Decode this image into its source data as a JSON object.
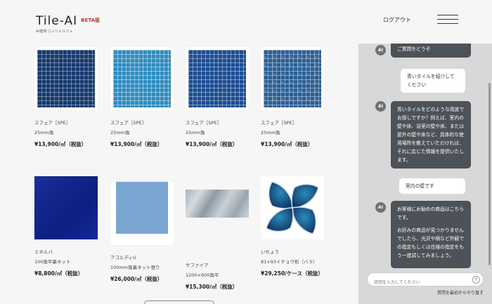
{
  "header": {
    "logo": "Tile-AI",
    "beta": "BETA版",
    "subtitle": "AI建材コンシェルジュ",
    "logout": "ログアウト"
  },
  "products": [
    {
      "name": "スフェア［SPE］",
      "spec": "25mm角",
      "price": "¥13,900/㎡（税抜）",
      "swatch": "mosaic-navy"
    },
    {
      "name": "スフェア［SPE］",
      "spec": "25mm角",
      "price": "¥13,900/㎡（税抜）",
      "swatch": "mosaic-sky"
    },
    {
      "name": "スフェア［SPE］",
      "spec": "25mm角",
      "price": "¥13,900/㎡（税抜）",
      "swatch": "mosaic-royal"
    },
    {
      "name": "スフェア［SPE］",
      "spec": "25mm角",
      "price": "¥13,900/㎡（税抜）",
      "swatch": "mosaic-mixed"
    },
    {
      "name": "ミネルバ",
      "spec": "100角平裏ネット",
      "price": "¥8,800/㎡（税抜）",
      "swatch": "solid-navy"
    },
    {
      "name": "アコルディU",
      "spec": "100mm角裏ネット張り",
      "price": "¥26,000/㎡（税抜）",
      "swatch": "solid-blue"
    },
    {
      "name": "サファイア",
      "spec": "1200×600角平",
      "price": "¥15,300/㎡（税抜）",
      "swatch": "marble"
    },
    {
      "name": "いちょう",
      "spec": "81×93イチョウ形（バラ）",
      "price": "¥29,250/ケース（税抜）",
      "swatch": "ginkgo"
    }
  ],
  "chat": {
    "messages": [
      {
        "role": "ai",
        "text": "ご質問をどうぞ"
      },
      {
        "role": "user",
        "text": "青いタイルを紹介してください"
      },
      {
        "role": "ai",
        "text": "青いタイルをどのような用途でお探しですか？例えば、室内の壁や床、浴室の壁や床、または屋外の壁や床など、具体的な使用場所を教えていただければ、それに応じた情報を提供いたします。"
      },
      {
        "role": "user",
        "text": "室内の壁です"
      },
      {
        "role": "ai",
        "text": "お客様にお勧めの商品はこちらです。"
      },
      {
        "role": "ai",
        "text": "お好みの商品が見つかりませんでしたら、光沢や柄など外観での指定もしくは往様の指定をもう一度試してみましょう。"
      }
    ],
    "ai_label": "AI",
    "input_placeholder": "質問を入力してください",
    "send_icon": "↑",
    "restart": "質問を最初からやり直す"
  },
  "colors": {
    "accent_beta": "#c0392b",
    "ai_bubble": "#4c5257",
    "chat_bg": "#d8d8d8"
  }
}
